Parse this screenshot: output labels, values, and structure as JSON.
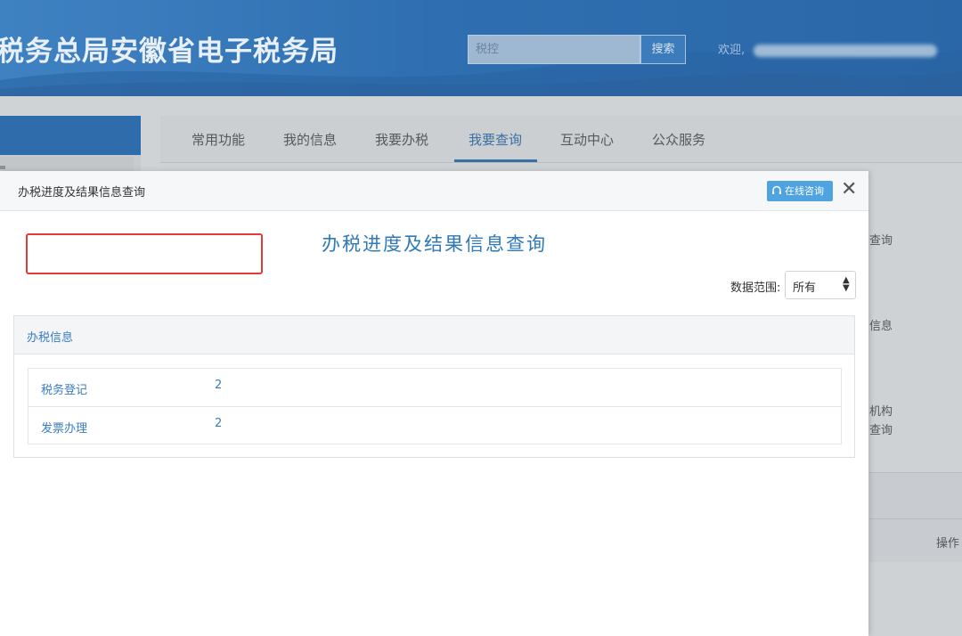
{
  "header": {
    "site_title": "税务总局安徽省电子税务局",
    "search_placeholder": "税控",
    "search_button": "搜索",
    "welcome": "欢迎,"
  },
  "nav": {
    "tabs": [
      {
        "label": "常用功能"
      },
      {
        "label": "我的信息"
      },
      {
        "label": "我要办税"
      },
      {
        "label": "我要查询"
      },
      {
        "label": "互动中心"
      },
      {
        "label": "公众服务"
      }
    ],
    "active_index": 3
  },
  "background_side": {
    "text1": "查询",
    "text2": "信息",
    "text3": "机构",
    "text4": "查询",
    "text5": "操作"
  },
  "modal": {
    "title": "办税进度及结果信息查询",
    "online_button": "在线咨询",
    "close": "✕",
    "heading": "办税进度及结果信息查询",
    "range_label": "数据范围:",
    "range_value": "所有",
    "panel_title": "办税信息",
    "rows": [
      {
        "name": "税务登记",
        "count": "2"
      },
      {
        "name": "发票办理",
        "count": "2"
      }
    ]
  },
  "colors": {
    "header_blue": "#2f6fb1",
    "accent_blue": "#3b7cc0",
    "highlight_red": "#e23b3b",
    "online_button": "#4fa3e0"
  }
}
